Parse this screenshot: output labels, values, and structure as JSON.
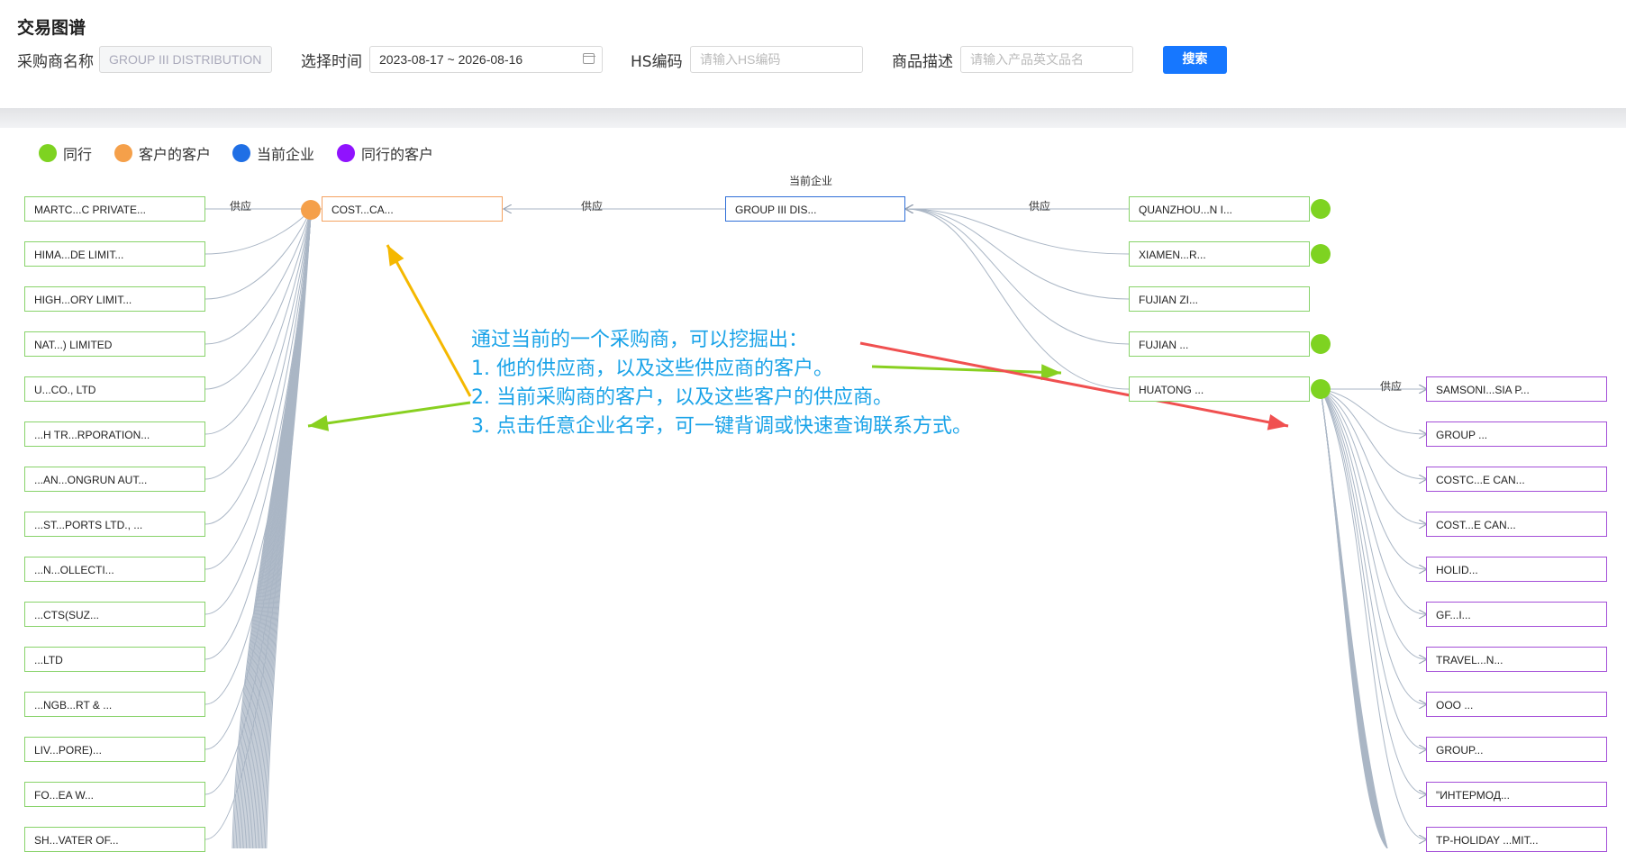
{
  "page": {
    "title": "交易图谱"
  },
  "filters": {
    "buyer_label": "采购商名称",
    "buyer_value": "GROUP III DISTRIBUTION",
    "time_label": "选择时间",
    "time_value": "2023-08-17 ~ 2026-08-16",
    "hs_label": "HS编码",
    "hs_placeholder": "请输入HS编码",
    "desc_label": "商品描述",
    "desc_placeholder": "请输入产品英文品名",
    "search_button": "搜索"
  },
  "legend": [
    {
      "label": "同行",
      "color": "#7ed321"
    },
    {
      "label": "客户的客户",
      "color": "#f5a04a"
    },
    {
      "label": "当前企业",
      "color": "#1f6fe5"
    },
    {
      "label": "同行的客户",
      "color": "#9013fe"
    }
  ],
  "graph": {
    "current_label": "当前企业",
    "edge_label": "供应",
    "center_node": "GROUP III DIS...",
    "customer_node": "COST...CA...",
    "left_nodes": [
      "MARTC...C PRIVATE...",
      "HIMA...DE LIMIT...",
      "HIGH...ORY LIMIT...",
      "NAT...) LIMITED",
      "U...CO., LTD",
      "...H TR...RPORATION...",
      "...AN...ONGRUN AUT...",
      "...ST...PORTS LTD., ...",
      "...N...OLLECTI...",
      "...CTS(SUZ...",
      "...LTD",
      "...NGB...RT & ...",
      "LIV...PORE)...",
      "FO...EA W...",
      "SH...VATER OF..."
    ],
    "right_nodes": [
      {
        "label": "QUANZHOU...N I...",
        "dot": true
      },
      {
        "label": "XIAMEN...R...",
        "dot": true
      },
      {
        "label": "FUJIAN ZI...",
        "dot": false
      },
      {
        "label": "FUJIAN ...",
        "dot": true
      },
      {
        "label": "HUATONG ...",
        "dot": true
      }
    ],
    "far_right_nodes": [
      "SAMSONI...SIA P...",
      "GROUP ...",
      "COSTC...E CAN...",
      "COST...E CAN...",
      "HOLID...",
      "GF...I...",
      "TRAVEL...N...",
      "OOO ...",
      "GROUP...",
      "\"ИНТЕРМОД...",
      "TP-HOLIDAY ...MIT..."
    ]
  },
  "annotation": {
    "lines": [
      "通过当前的一个采购商，可以挖掘出：",
      "1. 他的供应商，以及这些供应商的客户。",
      "2. 当前采购商的客户，以及这些客户的供应商。",
      "3. 点击任意企业名字，可一键背调或快速查询联系方式。"
    ],
    "arrow_colors": [
      "#f5b800",
      "#88d020",
      "#88d020",
      "#f05050"
    ]
  }
}
